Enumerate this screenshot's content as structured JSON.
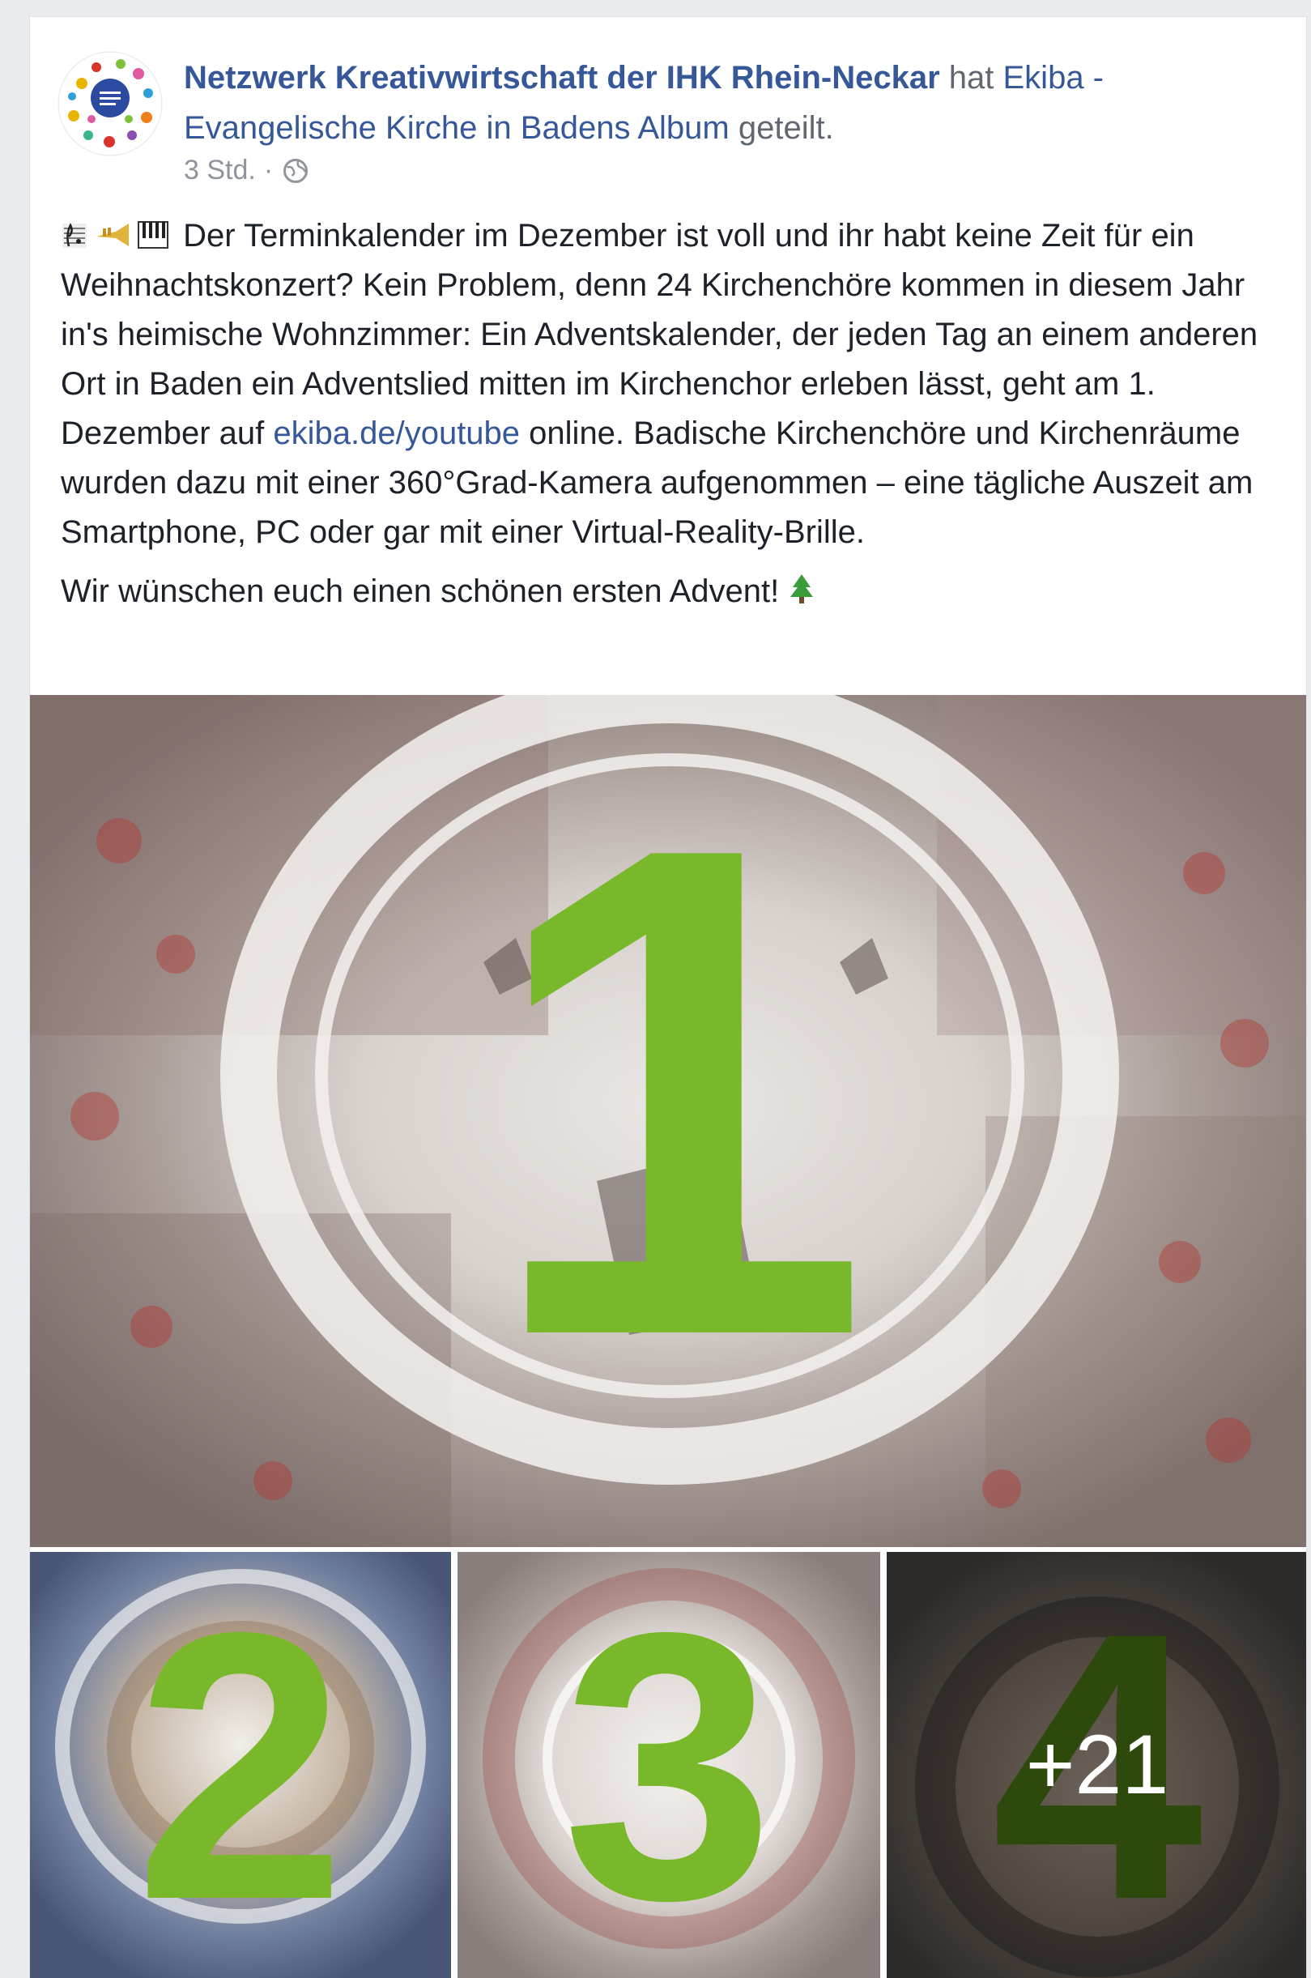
{
  "post": {
    "author": "Netzwerk Kreativwirtschaft der IHK Rhein-Neckar",
    "action_prefix": "hat",
    "shared_page": "Ekiba - Evangelische Kirche in Badens",
    "album": "Album",
    "action_suffix": "geteilt.",
    "timestamp": "3 Std.",
    "separator": "·",
    "privacy_icon": "globe-icon",
    "text_part1": "Der Terminkalender im Dezember ist voll und ihr habt keine Zeit für ein Weihnachtskonzert? Kein Problem, denn 24 Kirchenchöre kommen in diesem Jahr in's heimische Wohnzimmer: Ein Adventskalender, der jeden Tag an einem anderen Ort in Baden ein Adventslied mitten im Kirchenchor erleben lässt, geht am 1. Dezember auf",
    "text_link": "ekiba.de/youtube",
    "text_part2": "online. Badische Kirchenchöre und Kirchenräume wurden dazu mit einer 360°Grad-Kamera aufgenommen – eine tägliche Auszeit am Smartphone, PC oder gar mit einer Virtual-Reality-Brille.",
    "text_closing": "Wir wünschen euch einen schönen ersten Advent!",
    "emojis": [
      "musical-score-icon",
      "trumpet-icon",
      "piano-keys-icon"
    ],
    "closing_emoji": "tree-icon"
  },
  "photos": {
    "main_number": "1",
    "thumb1_number": "2",
    "thumb2_number": "3",
    "thumb3_number": "4",
    "more_count": "+21"
  },
  "colors": {
    "link": "#365899",
    "accent_green": "#79b82a",
    "text": "#1d2129",
    "meta": "#90949c"
  }
}
